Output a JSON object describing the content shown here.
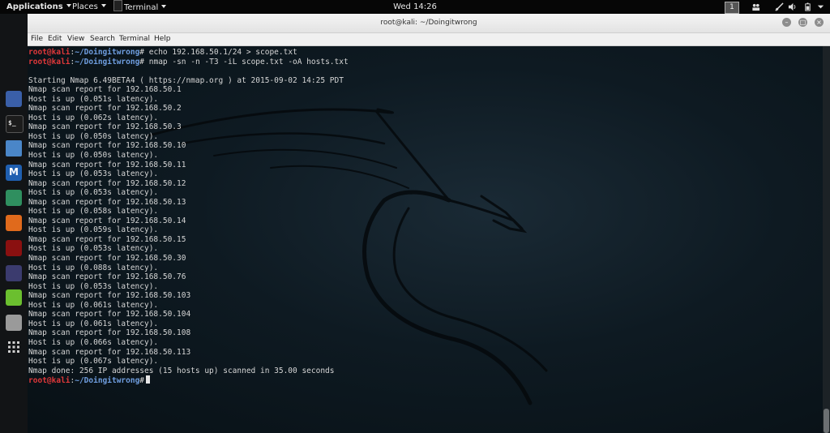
{
  "topbar": {
    "applications": "Applications",
    "places": "Places",
    "terminal": "Terminal",
    "clock": "Wed 14:26",
    "workspace": "1"
  },
  "window": {
    "title": "root@kali: ~/Doingitwrong",
    "menu": [
      "File",
      "Edit",
      "View",
      "Search",
      "Terminal",
      "Help"
    ]
  },
  "prompt": {
    "user": "root@kali",
    "sep": ":",
    "path": "~/Doingitwrong",
    "symbol": "#"
  },
  "terminal": {
    "lines": [
      {
        "type": "cmd",
        "text": " echo 192.168.50.1/24 > scope.txt"
      },
      {
        "type": "cmd",
        "text": " nmap -sn -n -T3 -iL scope.txt -oA hosts.txt"
      },
      {
        "type": "out",
        "text": ""
      },
      {
        "type": "out",
        "text": "Starting Nmap 6.49BETA4 ( https://nmap.org ) at 2015-09-02 14:25 PDT"
      },
      {
        "type": "out",
        "text": "Nmap scan report for 192.168.50.1"
      },
      {
        "type": "out",
        "text": "Host is up (0.051s latency)."
      },
      {
        "type": "out",
        "text": "Nmap scan report for 192.168.50.2"
      },
      {
        "type": "out",
        "text": "Host is up (0.062s latency)."
      },
      {
        "type": "out",
        "text": "Nmap scan report for 192.168.50.3"
      },
      {
        "type": "out",
        "text": "Host is up (0.050s latency)."
      },
      {
        "type": "out",
        "text": "Nmap scan report for 192.168.50.10"
      },
      {
        "type": "out",
        "text": "Host is up (0.050s latency)."
      },
      {
        "type": "out",
        "text": "Nmap scan report for 192.168.50.11"
      },
      {
        "type": "out",
        "text": "Host is up (0.053s latency)."
      },
      {
        "type": "out",
        "text": "Nmap scan report for 192.168.50.12"
      },
      {
        "type": "out",
        "text": "Host is up (0.053s latency)."
      },
      {
        "type": "out",
        "text": "Nmap scan report for 192.168.50.13"
      },
      {
        "type": "out",
        "text": "Host is up (0.058s latency)."
      },
      {
        "type": "out",
        "text": "Nmap scan report for 192.168.50.14"
      },
      {
        "type": "out",
        "text": "Host is up (0.059s latency)."
      },
      {
        "type": "out",
        "text": "Nmap scan report for 192.168.50.15"
      },
      {
        "type": "out",
        "text": "Host is up (0.053s latency)."
      },
      {
        "type": "out",
        "text": "Nmap scan report for 192.168.50.30"
      },
      {
        "type": "out",
        "text": "Host is up (0.088s latency)."
      },
      {
        "type": "out",
        "text": "Nmap scan report for 192.168.50.76"
      },
      {
        "type": "out",
        "text": "Host is up (0.053s latency)."
      },
      {
        "type": "out",
        "text": "Nmap scan report for 192.168.50.103"
      },
      {
        "type": "out",
        "text": "Host is up (0.061s latency)."
      },
      {
        "type": "out",
        "text": "Nmap scan report for 192.168.50.104"
      },
      {
        "type": "out",
        "text": "Host is up (0.061s latency)."
      },
      {
        "type": "out",
        "text": "Nmap scan report for 192.168.50.108"
      },
      {
        "type": "out",
        "text": "Host is up (0.066s latency)."
      },
      {
        "type": "out",
        "text": "Nmap scan report for 192.168.50.113"
      },
      {
        "type": "out",
        "text": "Host is up (0.067s latency)."
      },
      {
        "type": "out",
        "text": "Nmap done: 256 IP addresses (15 hosts up) scanned in 35.00 seconds"
      },
      {
        "type": "prompt",
        "text": ""
      }
    ]
  },
  "dock": [
    {
      "name": "iceweasel-icon",
      "color": "#3a5fa8"
    },
    {
      "name": "terminal-icon",
      "color": "#1c1c1c"
    },
    {
      "name": "files-icon",
      "color": "#4a86c8"
    },
    {
      "name": "metasploit-icon",
      "color": "#1f5fb0"
    },
    {
      "name": "armitage-icon",
      "color": "#2f8f5f"
    },
    {
      "name": "burpsuite-icon",
      "color": "#e06a1c"
    },
    {
      "name": "maltego-icon",
      "color": "#8a1010"
    },
    {
      "name": "beef-icon",
      "color": "#3b3b6e"
    },
    {
      "name": "leafpad-icon",
      "color": "#6bbf2f"
    },
    {
      "name": "faraday-icon",
      "color": "#9a9a9a"
    },
    {
      "name": "show-apps-icon",
      "color": "#121416"
    }
  ]
}
